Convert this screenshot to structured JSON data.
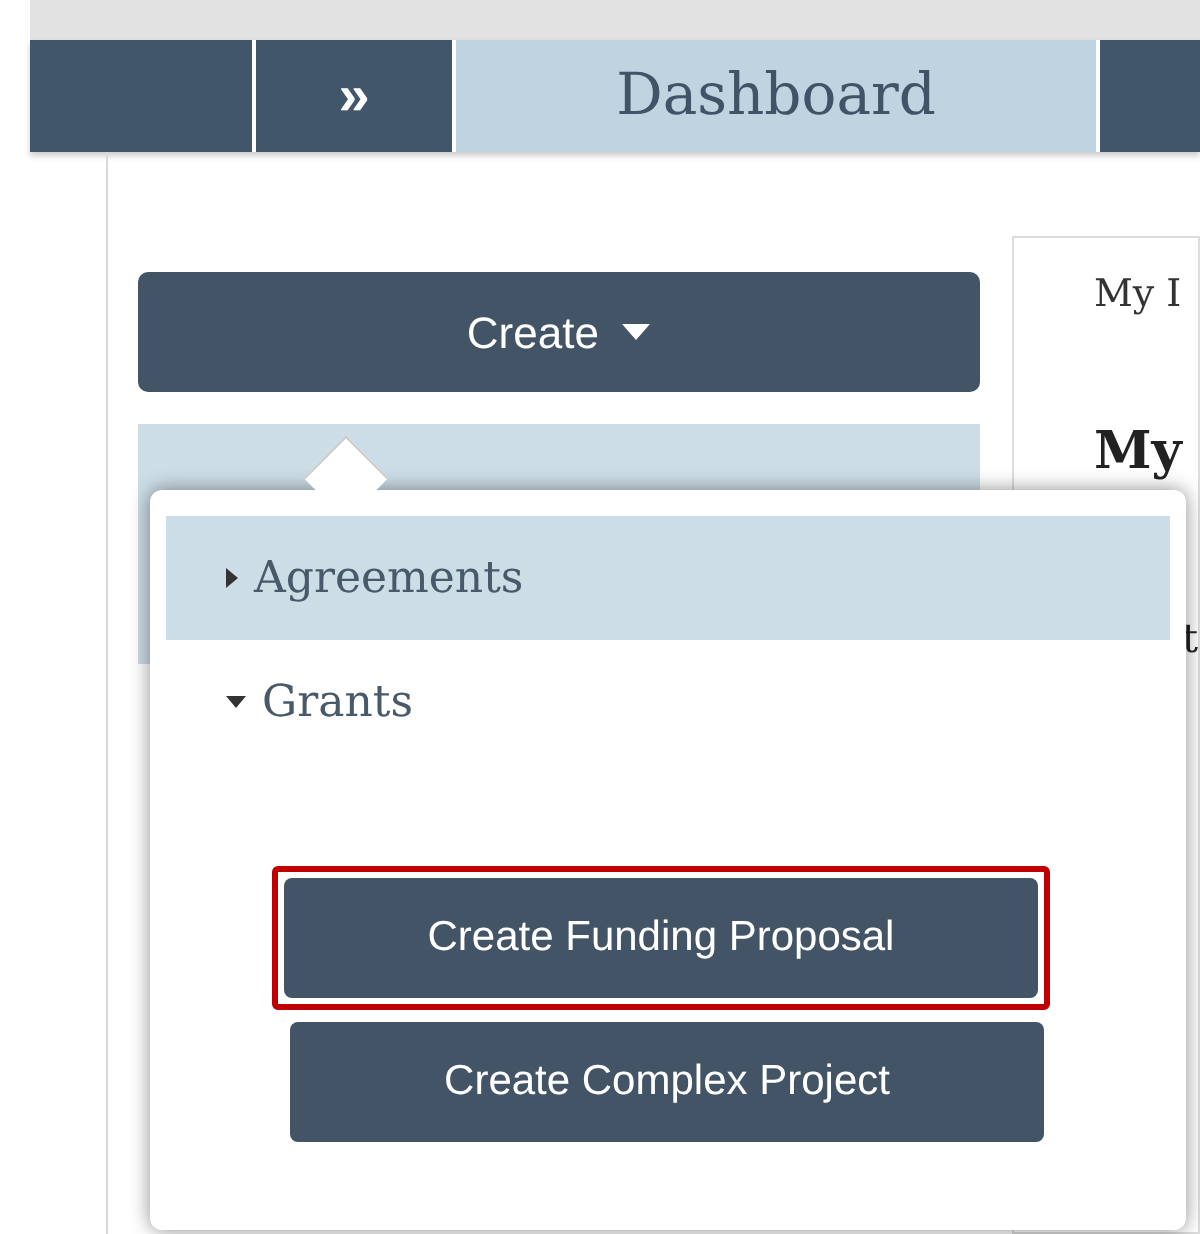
{
  "nav": {
    "expand_icon": "»",
    "title": "Dashboard"
  },
  "create_button": {
    "label": "Create",
    "expanded": true
  },
  "side_card": {
    "tab": "My I",
    "heading": "My",
    "line": "t"
  },
  "menu": {
    "categories": [
      {
        "label": "Agreements",
        "expanded": false,
        "selected": true
      },
      {
        "label": "Grants",
        "expanded": true,
        "selected": false,
        "actions": [
          {
            "label": "Create Funding Proposal",
            "highlighted": true
          },
          {
            "label": "Create Complex Project",
            "highlighted": false
          }
        ]
      }
    ]
  }
}
